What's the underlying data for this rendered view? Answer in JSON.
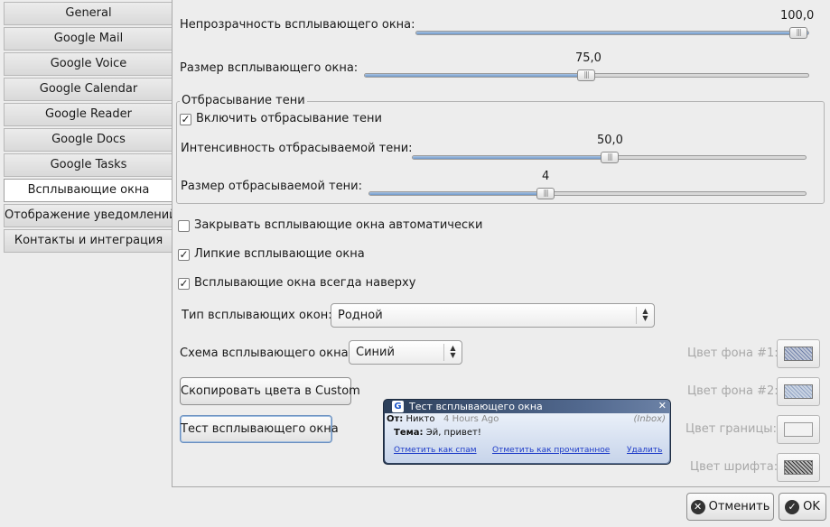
{
  "sidebar": {
    "items": [
      {
        "label": "General"
      },
      {
        "label": "Google Mail"
      },
      {
        "label": "Google Voice"
      },
      {
        "label": "Google Calendar"
      },
      {
        "label": "Google Reader"
      },
      {
        "label": "Google Docs"
      },
      {
        "label": "Google Tasks"
      },
      {
        "label": "Всплывающие окна",
        "active": true
      },
      {
        "label": "Отображение уведомлений"
      },
      {
        "label": "Контакты и интеграция"
      }
    ]
  },
  "opacity": {
    "label": "Непрозрачность всплывающего окна:",
    "value": "100,0",
    "fraction": 1.0
  },
  "size": {
    "label": "Размер всплывающего окна:",
    "value": "75,0",
    "fraction": 0.5
  },
  "shadow": {
    "frame_title": "Отбрасывание тени",
    "enable_label": "Включить отбрасывание тени",
    "enable_checked": true,
    "intensity": {
      "label": "Интенсивность отбрасываемой тени:",
      "value": "50,0",
      "fraction": 0.5
    },
    "shadow_size": {
      "label": "Размер отбрасываемой тени:",
      "value": "4",
      "fraction": 0.4
    }
  },
  "options": {
    "auto_close": {
      "label": "Закрывать всплывающие окна автоматически",
      "checked": false
    },
    "sticky": {
      "label": "Липкие всплывающие окна",
      "checked": true
    },
    "on_top": {
      "label": "Всплывающие окна всегда наверху",
      "checked": true
    }
  },
  "popup_type": {
    "label": "Тип всплывающих окон:",
    "value": "Родной"
  },
  "popup_scheme": {
    "label": "Схема всплывающего окна:",
    "value": "Синий"
  },
  "buttons": {
    "copy_colors": "Скопировать цвета в Custom",
    "test_popup": "Тест всплывающего окна",
    "cancel": "Отменить",
    "ok": "OK"
  },
  "colors": {
    "bg1": "Цвет фона #1:",
    "bg2": "Цвет фона #2:",
    "border": "Цвет границы:",
    "font": "Цвет шрифта:"
  },
  "preview": {
    "title": "Тест всплывающего окна",
    "from_label": "От:",
    "from_name": "Никто",
    "time": "4 Hours Ago",
    "folder": "(Inbox)",
    "subject_label": "Тема:",
    "subject": "Эй, привет!",
    "link_spam": "Отметить как спам",
    "link_read": "Отметить как прочитанное",
    "link_delete": "Удалить"
  },
  "accent": "#6f98c9"
}
